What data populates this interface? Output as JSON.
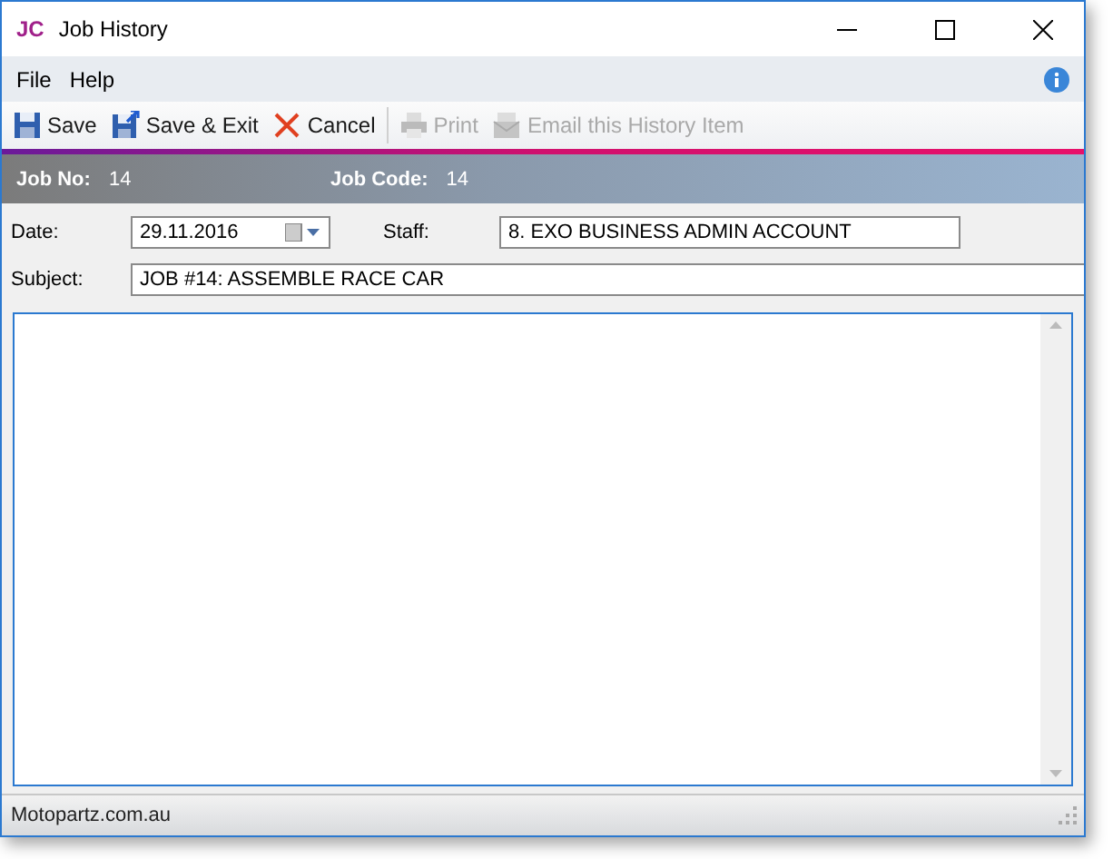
{
  "window": {
    "title": "Job History",
    "logo": "JC"
  },
  "menu": [
    "File",
    "Help"
  ],
  "toolbar": [
    {
      "label": "Save",
      "disabled": false
    },
    {
      "label": "Save & Exit",
      "disabled": false
    },
    {
      "label": "Cancel",
      "disabled": false
    },
    {
      "label": "Print",
      "disabled": true
    },
    {
      "label": "Email this History Item",
      "disabled": true
    }
  ],
  "header": [
    {
      "label": "Job No:",
      "value": "14"
    },
    {
      "label": "Job Code:",
      "value": "14"
    }
  ],
  "form": {
    "date_label": "Date:",
    "date": "29.11.2016",
    "staff_label": "Staff:",
    "staff": "8. EXO BUSINESS ADMIN ACCOUNT",
    "subject_label": "Subject:",
    "subject": "JOB #14: ASSEMBLE RACE CAR"
  },
  "status_bar": "Motopartz.com.au"
}
